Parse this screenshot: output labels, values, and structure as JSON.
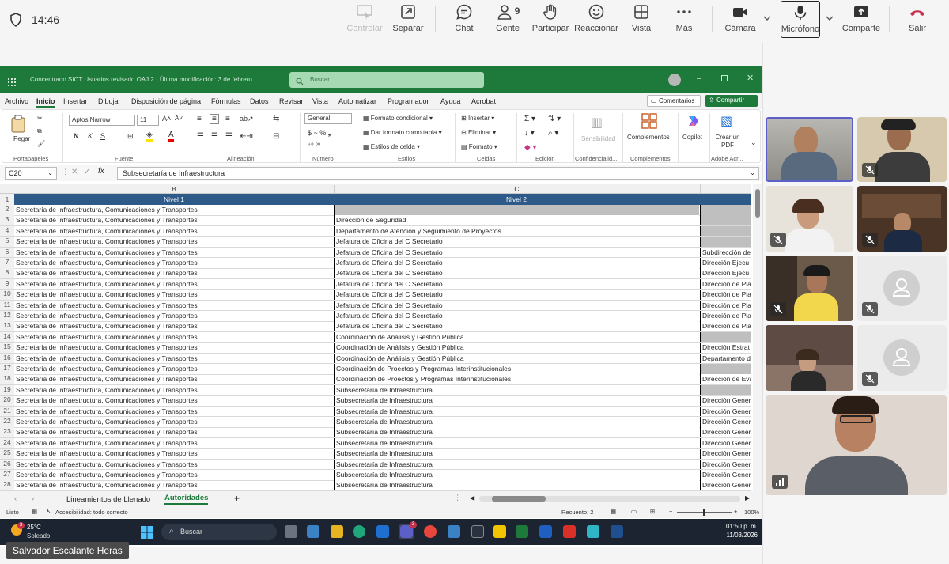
{
  "meeting": {
    "time": "14:46",
    "buttons": [
      {
        "id": "controlar",
        "label": "Controlar",
        "icon": "control-icon",
        "disabled": true
      },
      {
        "id": "separar",
        "label": "Separar",
        "icon": "popout-icon"
      },
      {
        "id": "chat",
        "label": "Chat",
        "icon": "chat-icon"
      },
      {
        "id": "gente",
        "label": "Gente",
        "icon": "people-icon",
        "count": "9"
      },
      {
        "id": "participar",
        "label": "Participar",
        "icon": "raise-hand-icon"
      },
      {
        "id": "reaccionar",
        "label": "Reaccionar",
        "icon": "smiley-icon"
      },
      {
        "id": "vista",
        "label": "Vista",
        "icon": "grid-icon"
      },
      {
        "id": "mas",
        "label": "Más",
        "icon": "more-icon"
      },
      {
        "id": "camara",
        "label": "Cámara",
        "icon": "camera-icon"
      },
      {
        "id": "microfono",
        "label": "Micrófono",
        "icon": "mic-icon"
      },
      {
        "id": "comparte",
        "label": "Comparte",
        "icon": "share-icon"
      },
      {
        "id": "salir",
        "label": "Salir",
        "icon": "hangup-icon"
      }
    ],
    "presenter_name": "Salvador Escalante Heras"
  },
  "excel": {
    "title": "Concentrado SICT Usuarios revisado OAJ 2 · Última modificación: 3 de febrero",
    "search_placeholder": "Buscar",
    "menu": [
      "Archivo",
      "Inicio",
      "Insertar",
      "Dibujar",
      "Disposición de página",
      "Fórmulas",
      "Datos",
      "Revisar",
      "Vista",
      "Automatizar",
      "Programador",
      "Ayuda",
      "Acrobat"
    ],
    "comments_label": "Comentarios",
    "share_label": "Compartir",
    "ribbon": {
      "paste": "Pegar",
      "font_name": "Aptos Narrow",
      "font_size": "11",
      "number_format": "General",
      "cond_format": "Formato condicional",
      "table_format": "Dar formato como tabla",
      "cell_styles": "Estilos de celda",
      "insert": "Insertar",
      "delete": "Eliminar",
      "format": "Formato",
      "sensitivity": "Sensibilidad",
      "addins": "Complementos",
      "copilot": "Copilot",
      "create_pdf": "Crear un PDF",
      "groups": {
        "clipboard": "Portapapeles",
        "font": "Fuente",
        "alignment": "Alineación",
        "number": "Número",
        "styles": "Estilos",
        "cells": "Celdas",
        "editing": "Edición",
        "confidential": "Confidencialid...",
        "addins": "Complementos",
        "adobe": "Adobe Acr..."
      }
    },
    "name_box": "C20",
    "formula": "Subsecretaría de Infraestructura",
    "col_b": "B",
    "col_c": "C",
    "header_b": "Nivel 1",
    "header_c": "Nivel 2",
    "rows": [
      {
        "n": "2",
        "b": "Secretaría de Infraestructura, Comunicaciones y Transportes",
        "c": "",
        "d": ""
      },
      {
        "n": "3",
        "b": "Secretaría de Infraestructura, Comunicaciones y Transportes",
        "c": "Dirección de Seguridad",
        "d": ""
      },
      {
        "n": "4",
        "b": "Secretaría de Infraestructura, Comunicaciones y Transportes",
        "c": "Departamento de Atención y Seguimiento de Proyectos",
        "d": ""
      },
      {
        "n": "5",
        "b": "Secretaría de Infraestructura, Comunicaciones y Transportes",
        "c": "Jefatura de Oficina del C Secretario",
        "d": ""
      },
      {
        "n": "6",
        "b": "Secretaría de Infraestructura, Comunicaciones y Transportes",
        "c": "Jefatura de Oficina del C Secretario",
        "d": "Subdirección de"
      },
      {
        "n": "7",
        "b": "Secretaría de Infraestructura, Comunicaciones y Transportes",
        "c": "Jefatura de Oficina del C Secretario",
        "d": "Dirección Ejecu"
      },
      {
        "n": "8",
        "b": "Secretaría de Infraestructura, Comunicaciones y Transportes",
        "c": "Jefatura de Oficina del C Secretario",
        "d": "Dirección Ejecu"
      },
      {
        "n": "9",
        "b": "Secretaría de Infraestructura, Comunicaciones y Transportes",
        "c": "Jefatura de Oficina del C Secretario",
        "d": "Dirección de Pla"
      },
      {
        "n": "10",
        "b": "Secretaría de Infraestructura, Comunicaciones y Transportes",
        "c": "Jefatura de Oficina del C Secretario",
        "d": "Dirección de Pla"
      },
      {
        "n": "11",
        "b": "Secretaría de Infraestructura, Comunicaciones y Transportes",
        "c": "Jefatura de Oficina del C Secretario",
        "d": "Dirección de Pla"
      },
      {
        "n": "12",
        "b": "Secretaría de Infraestructura, Comunicaciones y Transportes",
        "c": "Jefatura de Oficina del C Secretario",
        "d": "Dirección de Pla"
      },
      {
        "n": "13",
        "b": "Secretaría de Infraestructura, Comunicaciones y Transportes",
        "c": "Jefatura de Oficina del C Secretario",
        "d": "Dirección de Pla"
      },
      {
        "n": "14",
        "b": "Secretaría de Infraestructura, Comunicaciones y Transportes",
        "c": "Coordinación de Análisis y Gestión Pública",
        "d": ""
      },
      {
        "n": "15",
        "b": "Secretaría de Infraestructura, Comunicaciones y Transportes",
        "c": "Coordinación de Análisis y Gestión Pública",
        "d": "Dirección Estrat"
      },
      {
        "n": "16",
        "b": "Secretaría de Infraestructura, Comunicaciones y Transportes",
        "c": "Coordinación de Análisis y Gestión Pública",
        "d": "Departamento d"
      },
      {
        "n": "17",
        "b": "Secretaría de Infraestructura, Comunicaciones y Transportes",
        "c": "Coordinación de Proectos y Programas Interinstitucionales",
        "d": ""
      },
      {
        "n": "18",
        "b": "Secretaría de Infraestructura, Comunicaciones y Transportes",
        "c": "Coordinación de Proectos y Programas Interinstitucionales",
        "d": "Dirección de Eva"
      },
      {
        "n": "19",
        "b": "Secretaría de Infraestructura, Comunicaciones y Transportes",
        "c": "Subsecretaría de Infraestructura",
        "d": ""
      },
      {
        "n": "20",
        "b": "Secretaría de Infraestructura, Comunicaciones y Transportes",
        "c": "Subsecretaría de Infraestructura",
        "d": "Dirección Gener"
      },
      {
        "n": "21",
        "b": "Secretaría de Infraestructura, Comunicaciones y Transportes",
        "c": "Subsecretaría de Infraestructura",
        "d": "Dirección Gener"
      },
      {
        "n": "22",
        "b": "Secretaría de Infraestructura, Comunicaciones y Transportes",
        "c": "Subsecretaría de Infraestructura",
        "d": "Dirección Gener"
      },
      {
        "n": "23",
        "b": "Secretaría de Infraestructura, Comunicaciones y Transportes",
        "c": "Subsecretaría de Infraestructura",
        "d": "Dirección Gener"
      },
      {
        "n": "24",
        "b": "Secretaría de Infraestructura, Comunicaciones y Transportes",
        "c": "Subsecretaría de Infraestructura",
        "d": "Dirección Gener"
      },
      {
        "n": "25",
        "b": "Secretaría de Infraestructura, Comunicaciones y Transportes",
        "c": "Subsecretaría de Infraestructura",
        "d": "Dirección Gener"
      },
      {
        "n": "26",
        "b": "Secretaría de Infraestructura, Comunicaciones y Transportes",
        "c": "Subsecretaría de Infraestructura",
        "d": "Dirección Gener"
      },
      {
        "n": "27",
        "b": "Secretaría de Infraestructura, Comunicaciones y Transportes",
        "c": "Subsecretaría de Infraestructura",
        "d": "Dirección Gener"
      },
      {
        "n": "28",
        "b": "Secretaría de Infraestructura, Comunicaciones y Transportes",
        "c": "Subsecretaría de Infraestructura",
        "d": "Dirección Gener"
      }
    ],
    "sheets": [
      "Lineamientos de Llenado",
      "Autoridades"
    ],
    "active_sheet": "Autoridades",
    "status": {
      "ready": "Listo",
      "accessibility": "Accesibilidad: todo correcto",
      "count": "Recuento: 2",
      "zoom": "100%"
    }
  },
  "taskbar": {
    "weather_temp": "25°C",
    "weather_desc": "Soleado",
    "search": "Buscar",
    "clock_time": "01:50 p. m.",
    "clock_date": "11/03/2026",
    "badge_weather": "3",
    "badge_teams": "3"
  },
  "colors": {
    "excel_green": "#1e7a3b",
    "header_blue": "#2e5a8a",
    "gray_fill": "#bfbfbf",
    "active_tile": "#5b5fc7"
  }
}
